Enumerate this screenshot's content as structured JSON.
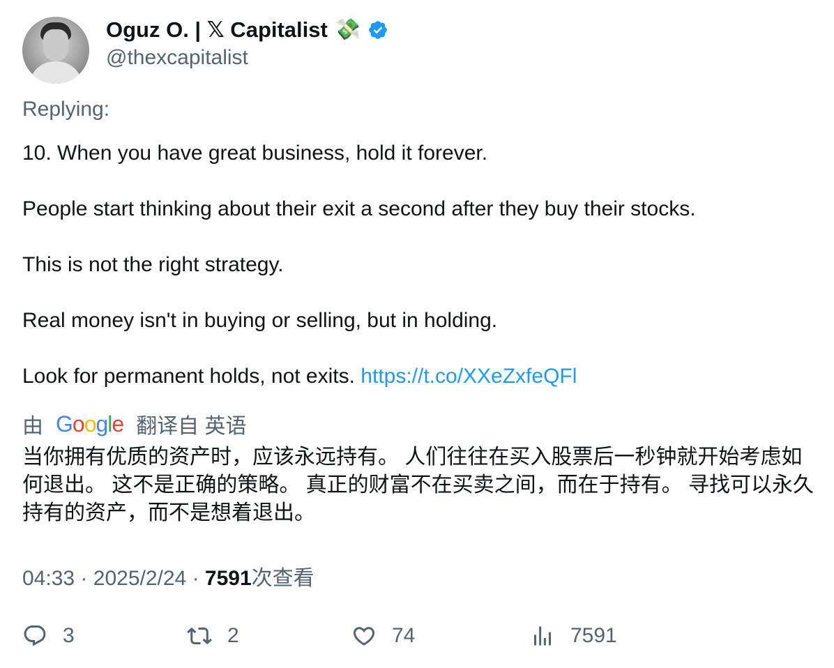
{
  "author": {
    "display_name": "Oguz O. | 𝕏 Capitalist",
    "emoji": "💸",
    "handle": "@thexcapitalist",
    "verified": true,
    "avatar_icon": "profile-photo"
  },
  "replying_label": "Replying:",
  "tweet": {
    "paragraphs": [
      "10. When you have great business, hold it forever.",
      "People start thinking about their exit a second after they buy their stocks.",
      "This is not the right strategy.",
      "Real money isn't in buying or selling, but in holding."
    ],
    "last_paragraph_text": "Look for permanent holds, not exits.",
    "link": "https://t.co/XXeZxfeQFl"
  },
  "translation": {
    "prefix": "由",
    "provider": "Google",
    "suffix": "翻译自 英语",
    "text": "当你拥有优质的资产时，应该永远持有。 人们往往在买入股票后一秒钟就开始考虑如何退出。 这不是正确的策略。 真正的财富不在买卖之间，而在于持有。 寻找可以永久持有的资产，而不是想着退出。"
  },
  "meta": {
    "time": "04:33",
    "separator": "·",
    "date": "2025/2/24",
    "views_count": "7591",
    "views_label": "次查看"
  },
  "actions": {
    "replies": "3",
    "retweets": "2",
    "likes": "74",
    "views": "7591"
  },
  "colors": {
    "text": "#0f1419",
    "secondary": "#536471",
    "link": "#1d9bf0",
    "verified": "#1d9bf0"
  }
}
